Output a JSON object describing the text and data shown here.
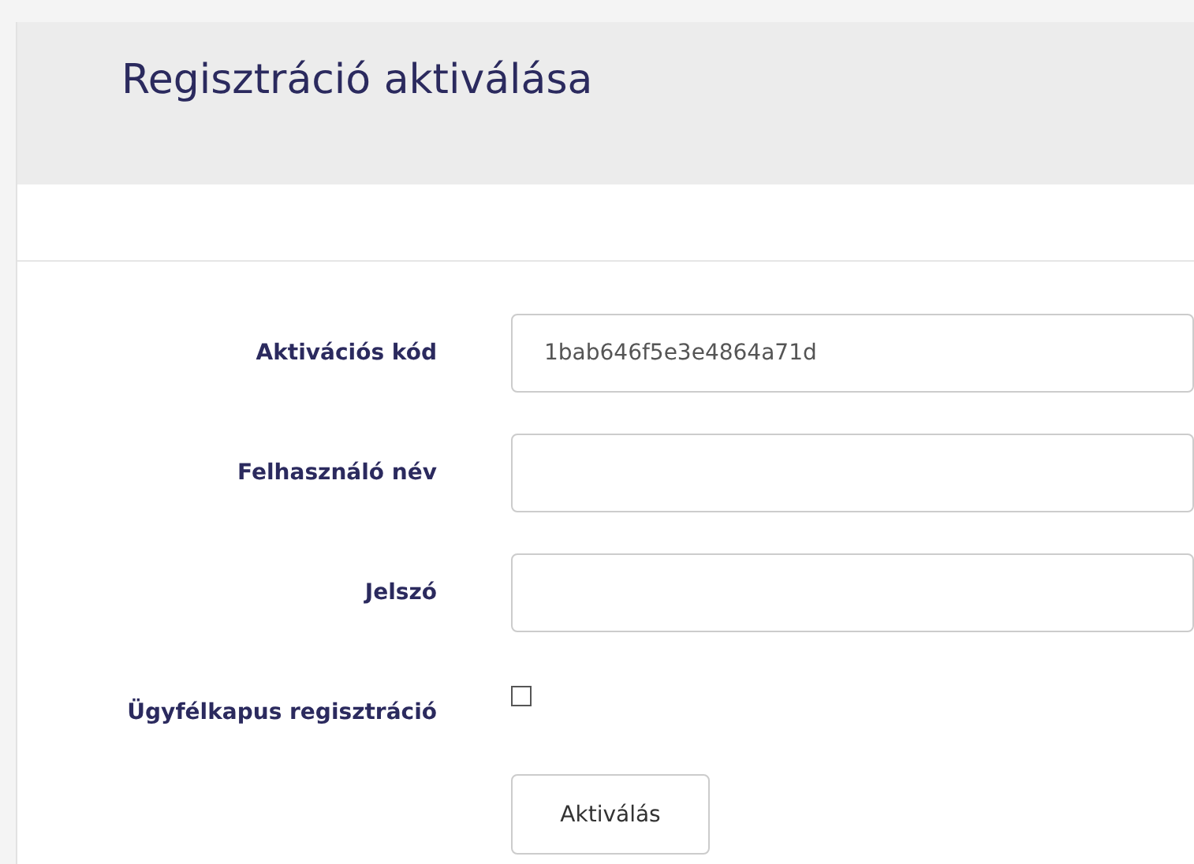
{
  "page": {
    "title": "Regisztráció aktiválása"
  },
  "form": {
    "fields": [
      {
        "kind": "text",
        "label": "Aktivációs kód",
        "value": "1bab646f5e3e4864a71d"
      },
      {
        "kind": "text",
        "label": "Felhasználó név"
      },
      {
        "kind": "password",
        "label": "Jelszó"
      },
      {
        "kind": "checkbox",
        "label": "Ügyfélkapus regisztráció",
        "checked": false
      }
    ],
    "submit": "Aktiválás"
  }
}
